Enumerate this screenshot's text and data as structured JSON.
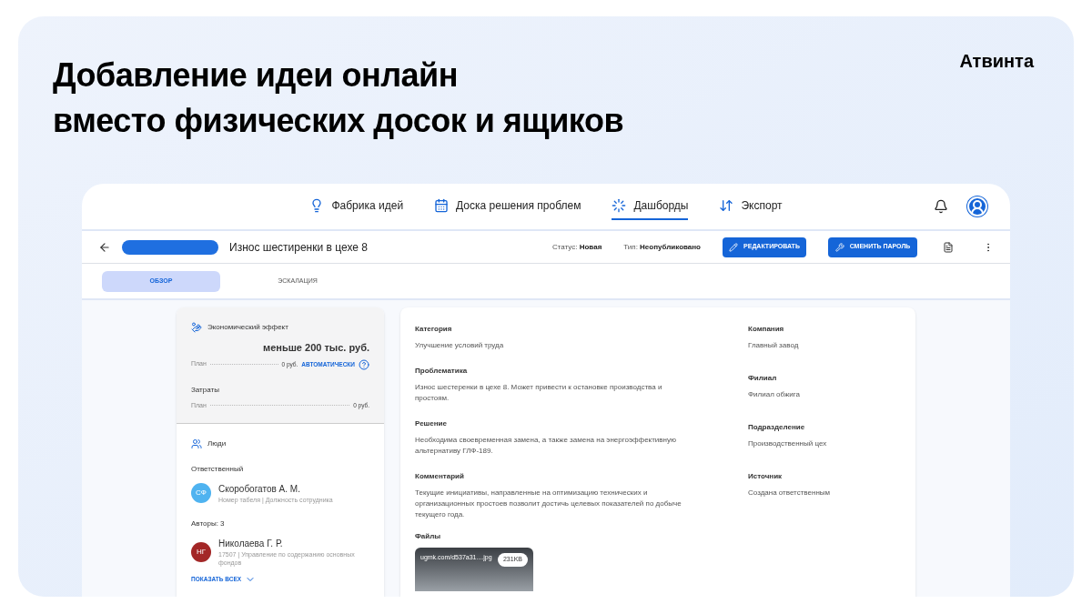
{
  "headline": [
    "Добавление идеи онлайн",
    "вместо физических досок и ящиков"
  ],
  "logo": {
    "text": "Атвинта"
  },
  "nav": [
    {
      "kind": "bulb",
      "label": "Фабрика идей",
      "selected": false
    },
    {
      "kind": "board",
      "label": "Доска решения проблем",
      "selected": false
    },
    {
      "kind": "dashboard",
      "label": "Дашборды",
      "selected": true
    },
    {
      "kind": "export",
      "label": "Экспорт",
      "selected": false
    }
  ],
  "header": {
    "title": "Износ шестиренки в цехе 8",
    "status_label": "Статус:",
    "status": "Новая",
    "type_label": "Тип:",
    "type": "Неопубликовано",
    "edit_button": "РЕДАКТИРОВАТЬ",
    "password_button": "СМЕНИТЬ ПАРОЛЬ"
  },
  "tabs": [
    {
      "label": "ОБЗОР",
      "selected": true
    },
    {
      "label": "ЭСКАЛАЦИЯ",
      "selected": false
    }
  ],
  "economy": {
    "title": "Экономический эффект",
    "amount": "меньше 200 тыс. руб.",
    "plan_label": "План",
    "plan_value": "0 руб.",
    "auto_link": "АВТОМАТИЧЕСКИ",
    "costs_title": "Затраты",
    "costs_plan_label": "План",
    "costs_plan_value": "0 руб."
  },
  "people": {
    "title": "Люди",
    "responsible_title": "Ответственный",
    "responsible": {
      "initials": "СФ",
      "color": "#4fb3f0",
      "name": "Скоробогатов А. М.",
      "meta": "Номер табеля | Должность сотрудника"
    },
    "authors_title": "Авторы: 3",
    "authors": [
      {
        "initials": "НГ",
        "color": "#a32727",
        "name": "Николаева Г. Р.",
        "meta": "17507 | Управление по содержанию основных фондов"
      }
    ],
    "show_all": "ПОКАЗАТЬ ВСЕХ"
  },
  "details_left": [
    {
      "label": "Категория",
      "value": "Улучшение условий труда"
    },
    {
      "label": "Проблематика",
      "value": "Износ шестеренки в цехе 8. Может привести к остановке производства и простоям."
    },
    {
      "label": "Решение",
      "value": "Необходима своевременная замена, а также замена на энергоэффективную альтернативу ГЛФ-189."
    },
    {
      "label": "Комментарий",
      "value": "Текущие инициативы, направленные на оптимизацию технических и организационных простоев позволит достичь целевых показателей по добыче текущего года."
    }
  ],
  "details_right": [
    {
      "label": "Компания",
      "value": "Главный завод"
    },
    {
      "label": "Филиал",
      "value": "Филиал обжига"
    },
    {
      "label": "Подразделение",
      "value": "Производственный цех"
    },
    {
      "label": "Источник",
      "value": "Создана ответственным"
    }
  ],
  "files": {
    "title": "Файлы",
    "items": [
      {
        "name": "ugmk.com/d537a31....jpg",
        "size": "231KB"
      }
    ]
  }
}
